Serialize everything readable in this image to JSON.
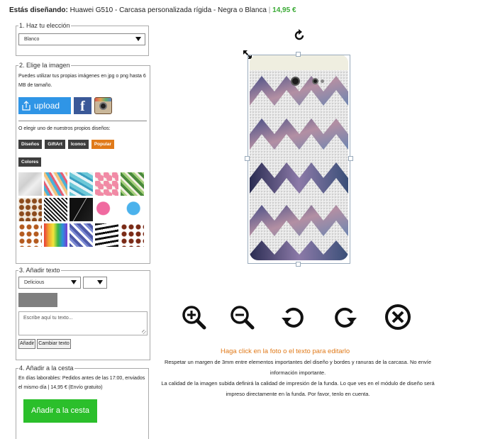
{
  "header": {
    "designing_label": "Estás diseñando:",
    "product": "Huawei G510 - Carcasa personalizada rígida - Negra o Blanca",
    "separator": "|",
    "price": "14,95 €"
  },
  "step1": {
    "legend": "1. Haz tu elección",
    "color_value": "Blanco"
  },
  "step2": {
    "legend": "2. Elige la imagen",
    "help": "Puedes utilizar tus propias imágenes en jpg o png hasta 6 MB de tamaño.",
    "upload_label": "upload",
    "facebook_label": "f",
    "own_designs": "O elegir uno de nuestros propios diseños:",
    "categories": [
      "Diseños",
      "GiftArt",
      "Iconos",
      "Popular"
    ],
    "categories_row2": [
      "Colores"
    ],
    "active_category": "Popular",
    "tiles_count": 15
  },
  "step3": {
    "legend": "3. Añadir texto",
    "font_value": "Delicious",
    "size_value": "",
    "text_placeholder": "Escribe aquí tu texto...",
    "add_button": "Añadir",
    "change_button": "Cambiar texto"
  },
  "step4": {
    "legend": "4. Añadir a la cesta",
    "info": "En días laborables: Pedidos antes de las 17:00, enviados el mismo día | 14,95 € (Envío gratuito)",
    "cart_button": "Añadir a la cesta"
  },
  "editor": {
    "click_hint": "Haga click en la foto o el texto para editarlo",
    "note1": "Respetar un margen de 3mm entre elementos importantes del diseño y bordes y ranuras de la carcasa. No envíe información importante.",
    "note2": "La calidad de la imagen subida definirá la calidad de impresión de la funda. Lo que ves en el módulo de diseño será impreso directamente en la funda. Por favor, tenlo en cuenta.",
    "tools": [
      "zoom-in-icon",
      "zoom-out-icon",
      "rotate-left-icon",
      "rotate-right-icon",
      "remove-icon"
    ]
  },
  "colors": {
    "price_green": "#3aaa35",
    "accent_orange": "#e07a1a",
    "upload_blue": "#2f95e6",
    "cart_green": "#2bbf2b"
  }
}
